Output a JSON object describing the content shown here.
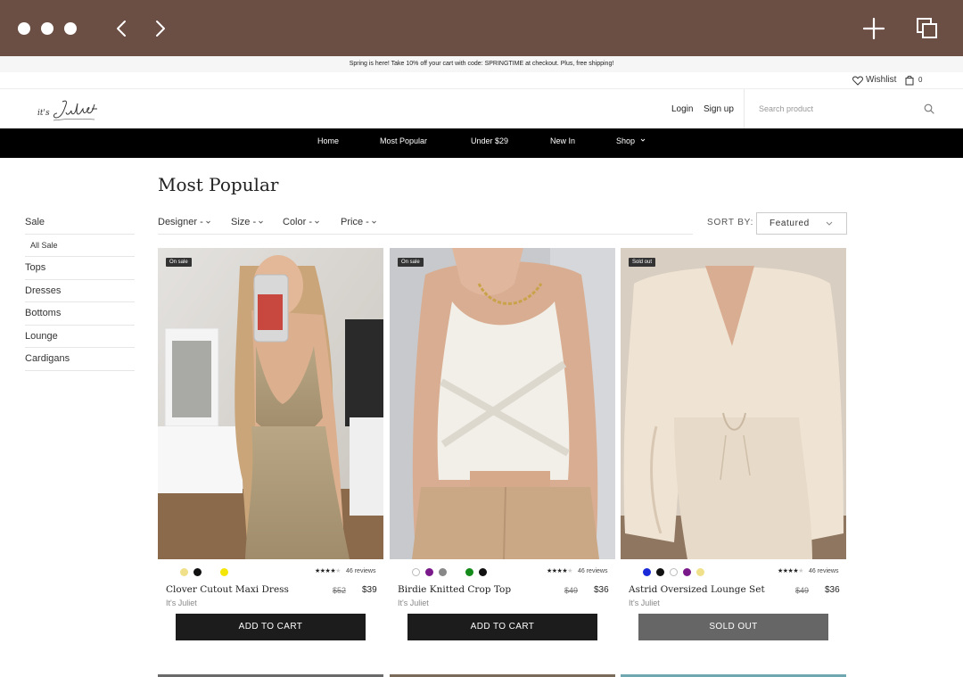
{
  "promo": {
    "text": "Spring is here! Take 10% off your cart with code: SPRINGTIME at checkout. Plus, free shipping!"
  },
  "utility": {
    "wishlist_label": "Wishlist",
    "cart_count": "0"
  },
  "header": {
    "logo_text": "it's Juliet",
    "login": "Login",
    "signup": "Sign up",
    "search_placeholder": "Search product"
  },
  "nav": {
    "items": [
      "Home",
      "Most Popular",
      "Under $29",
      "New In",
      "Shop"
    ]
  },
  "page": {
    "title": "Most Popular"
  },
  "sidebar": {
    "items": [
      "Sale",
      "All Sale",
      "Tops",
      "Dresses",
      "Bottoms",
      "Lounge",
      "Cardigans"
    ]
  },
  "filters": {
    "items": [
      "Designer -",
      "Size -",
      "Color -",
      "Price -"
    ],
    "sort_label": "SORT BY:",
    "sort_value": "Featured"
  },
  "products": [
    {
      "badge": "On sale",
      "name": "Clover Cutout Maxi Dress",
      "brand": "It's Juliet",
      "old_price": "$52",
      "price": "$39",
      "reviews": "46 reviews",
      "stars": "★★★★★",
      "rating": 4,
      "swatches": [
        "#f0e08a",
        "#111111",
        "#ffffff",
        "#f5e60a"
      ],
      "button": "ADD TO CART",
      "sold": false
    },
    {
      "badge": "On sale",
      "name": "Birdie Knitted Crop Top",
      "brand": "It's Juliet",
      "old_price": "$49",
      "price": "$36",
      "reviews": "46 reviews",
      "stars": "★★★★★",
      "rating": 4,
      "swatches": [
        "#ffffff",
        "#7a1a8a",
        "#888888",
        "#ffffff",
        "#138a1a",
        "#111111"
      ],
      "button": "ADD TO CART",
      "sold": false
    },
    {
      "badge": "Sold out",
      "name": "Astrid Oversized Lounge Set",
      "brand": "It's Juliet",
      "old_price": "$49",
      "price": "$36",
      "reviews": "46 reviews",
      "stars": "★★★★★",
      "rating": 4,
      "swatches": [
        "#1a2ad8",
        "#111111",
        "#ffffff",
        "#7a1a8a",
        "#f0e08a"
      ],
      "button": "SOLD OUT",
      "sold": true
    }
  ],
  "colors": {
    "chrome": "#6b4e44",
    "nav_bg": "#000000",
    "button_dark": "#1c1c1c",
    "button_sold": "#666666"
  }
}
